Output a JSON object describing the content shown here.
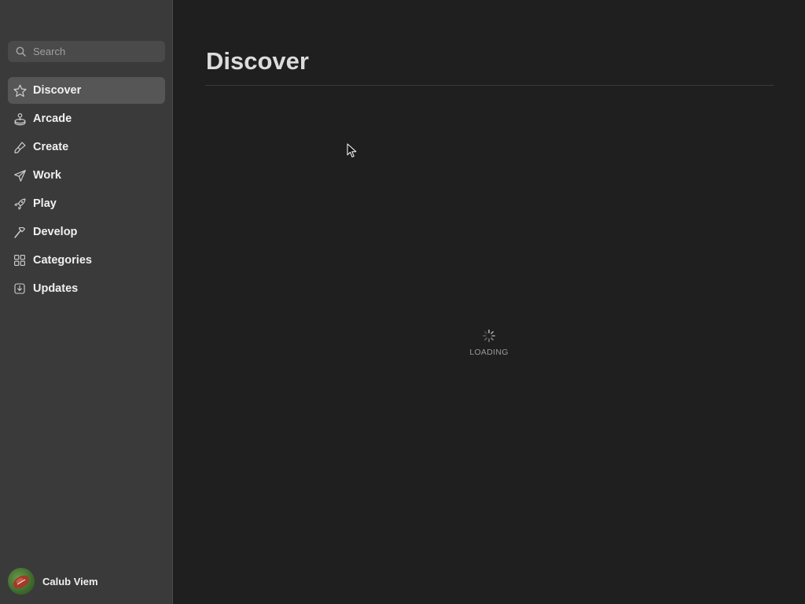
{
  "search": {
    "placeholder": "Search",
    "icon": "search-icon"
  },
  "sidebar": {
    "items": [
      {
        "label": "Discover",
        "icon": "star-icon",
        "active": true
      },
      {
        "label": "Arcade",
        "icon": "joystick-icon",
        "active": false
      },
      {
        "label": "Create",
        "icon": "brush-icon",
        "active": false
      },
      {
        "label": "Work",
        "icon": "paper-plane-icon",
        "active": false
      },
      {
        "label": "Play",
        "icon": "rocket-icon",
        "active": false
      },
      {
        "label": "Develop",
        "icon": "hammer-icon",
        "active": false
      },
      {
        "label": "Categories",
        "icon": "grid-icon",
        "active": false
      },
      {
        "label": "Updates",
        "icon": "download-box-icon",
        "active": false
      }
    ]
  },
  "user": {
    "name": "Calub Viem"
  },
  "main": {
    "title": "Discover",
    "loading_text": "LOADING"
  },
  "colors": {
    "sidebar_bg": "#3a3a3a",
    "main_bg": "#1f1f1f",
    "active_item_bg": "#565656"
  }
}
